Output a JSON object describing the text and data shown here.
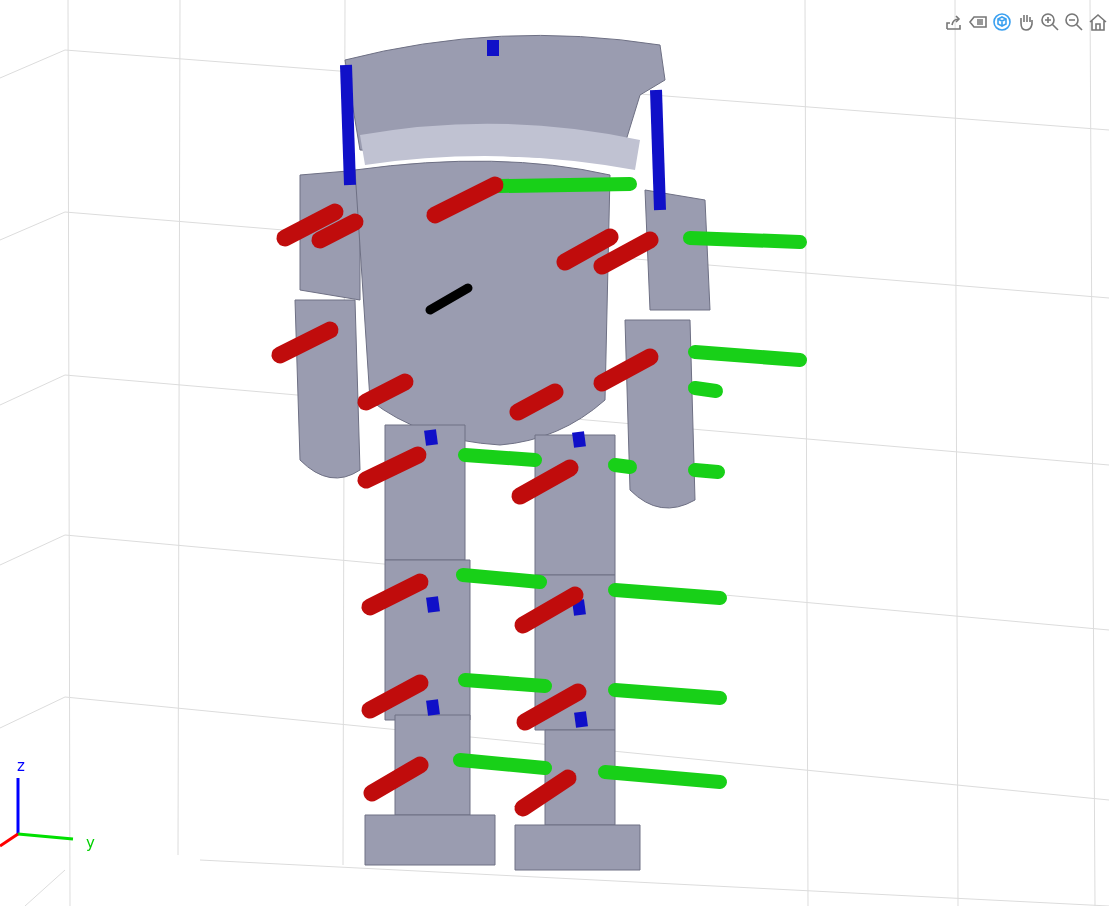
{
  "toolbar": [
    {
      "kind": "export",
      "selected": false
    },
    {
      "kind": "datatips",
      "selected": false
    },
    {
      "kind": "rotate",
      "selected": true
    },
    {
      "kind": "pan",
      "selected": false
    },
    {
      "kind": "zoomin",
      "selected": false
    },
    {
      "kind": "zoomout",
      "selected": false
    },
    {
      "kind": "home",
      "selected": false
    }
  ],
  "axes_triad": {
    "z_label": "z",
    "y_label": "y"
  }
}
